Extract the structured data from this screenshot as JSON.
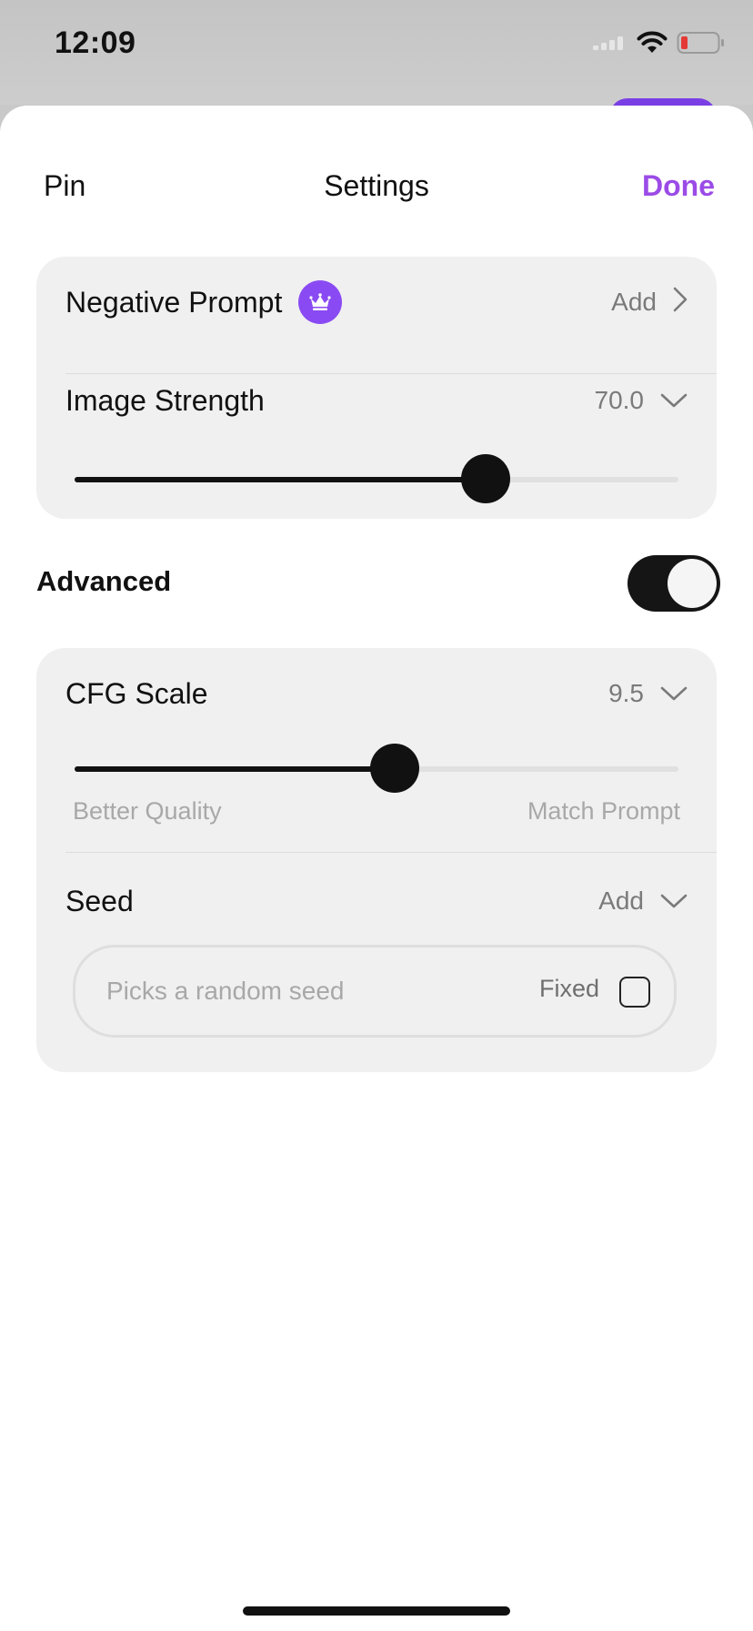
{
  "status_bar": {
    "time": "12:09"
  },
  "nav": {
    "left_label": "Pin",
    "title": "Settings",
    "done_label": "Done"
  },
  "card_prompt": {
    "negative_prompt": {
      "label": "Negative Prompt",
      "badge_icon": "crown-icon",
      "action_label": "Add"
    },
    "image_strength": {
      "label": "Image Strength",
      "value": "70.0",
      "slider_fraction": 0.68
    }
  },
  "advanced": {
    "label": "Advanced",
    "enabled": true
  },
  "card_advanced": {
    "cfg_scale": {
      "label": "CFG Scale",
      "value": "9.5",
      "slider_fraction": 0.53,
      "min_caption": "Better Quality",
      "max_caption": "Match Prompt"
    },
    "seed": {
      "label": "Seed",
      "action_label": "Add",
      "input_value": "",
      "input_placeholder": "Picks a random seed",
      "fixed_label": "Fixed",
      "fixed_checked": false
    }
  },
  "colors": {
    "accent": "#9b4be6",
    "badge": "#8a4af3",
    "card_bg": "#f0f0f0",
    "toggle_on": "#151515"
  }
}
